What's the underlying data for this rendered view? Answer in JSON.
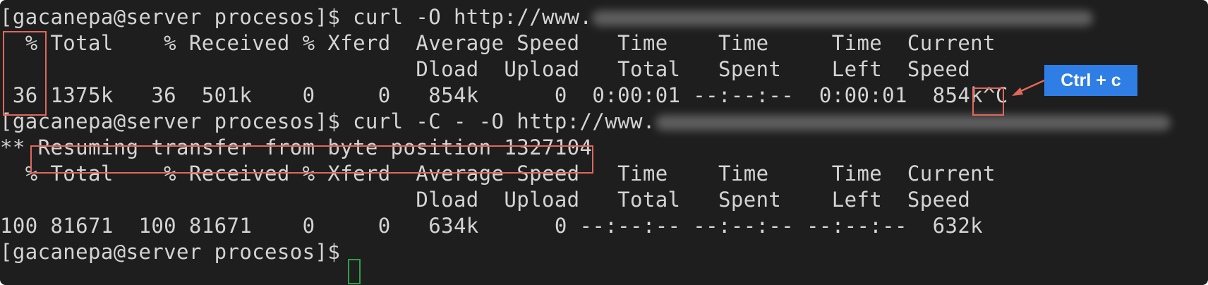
{
  "terminal": {
    "lines": [
      "[gacanepa@server procesos]$ curl -O http://www.",
      "  % Total    % Received % Xferd  Average Speed   Time    Time     Time  Current",
      "                                 Dload  Upload   Total   Spent    Left  Speed",
      " 36 1375k   36  501k    0     0   854k      0  0:00:01 --:--:--  0:00:01  854k^C",
      "[gacanepa@server procesos]$ curl -C - -O http://www.",
      "** Resuming transfer from byte position 1327104",
      "  % Total    % Received % Xferd  Average Speed   Time    Time     Time  Current",
      "                                 Dload  Upload   Total   Spent    Left  Speed",
      "100 81671  100 81671    0     0   634k      0 --:--:-- --:--:-- --:--:--  632k",
      "[gacanepa@server procesos]$ "
    ]
  },
  "annotation": {
    "label": "Ctrl + c",
    "box_color": "#e0675c",
    "badge_color": "#2f7ee6",
    "cursor_color": "#2ea043"
  }
}
